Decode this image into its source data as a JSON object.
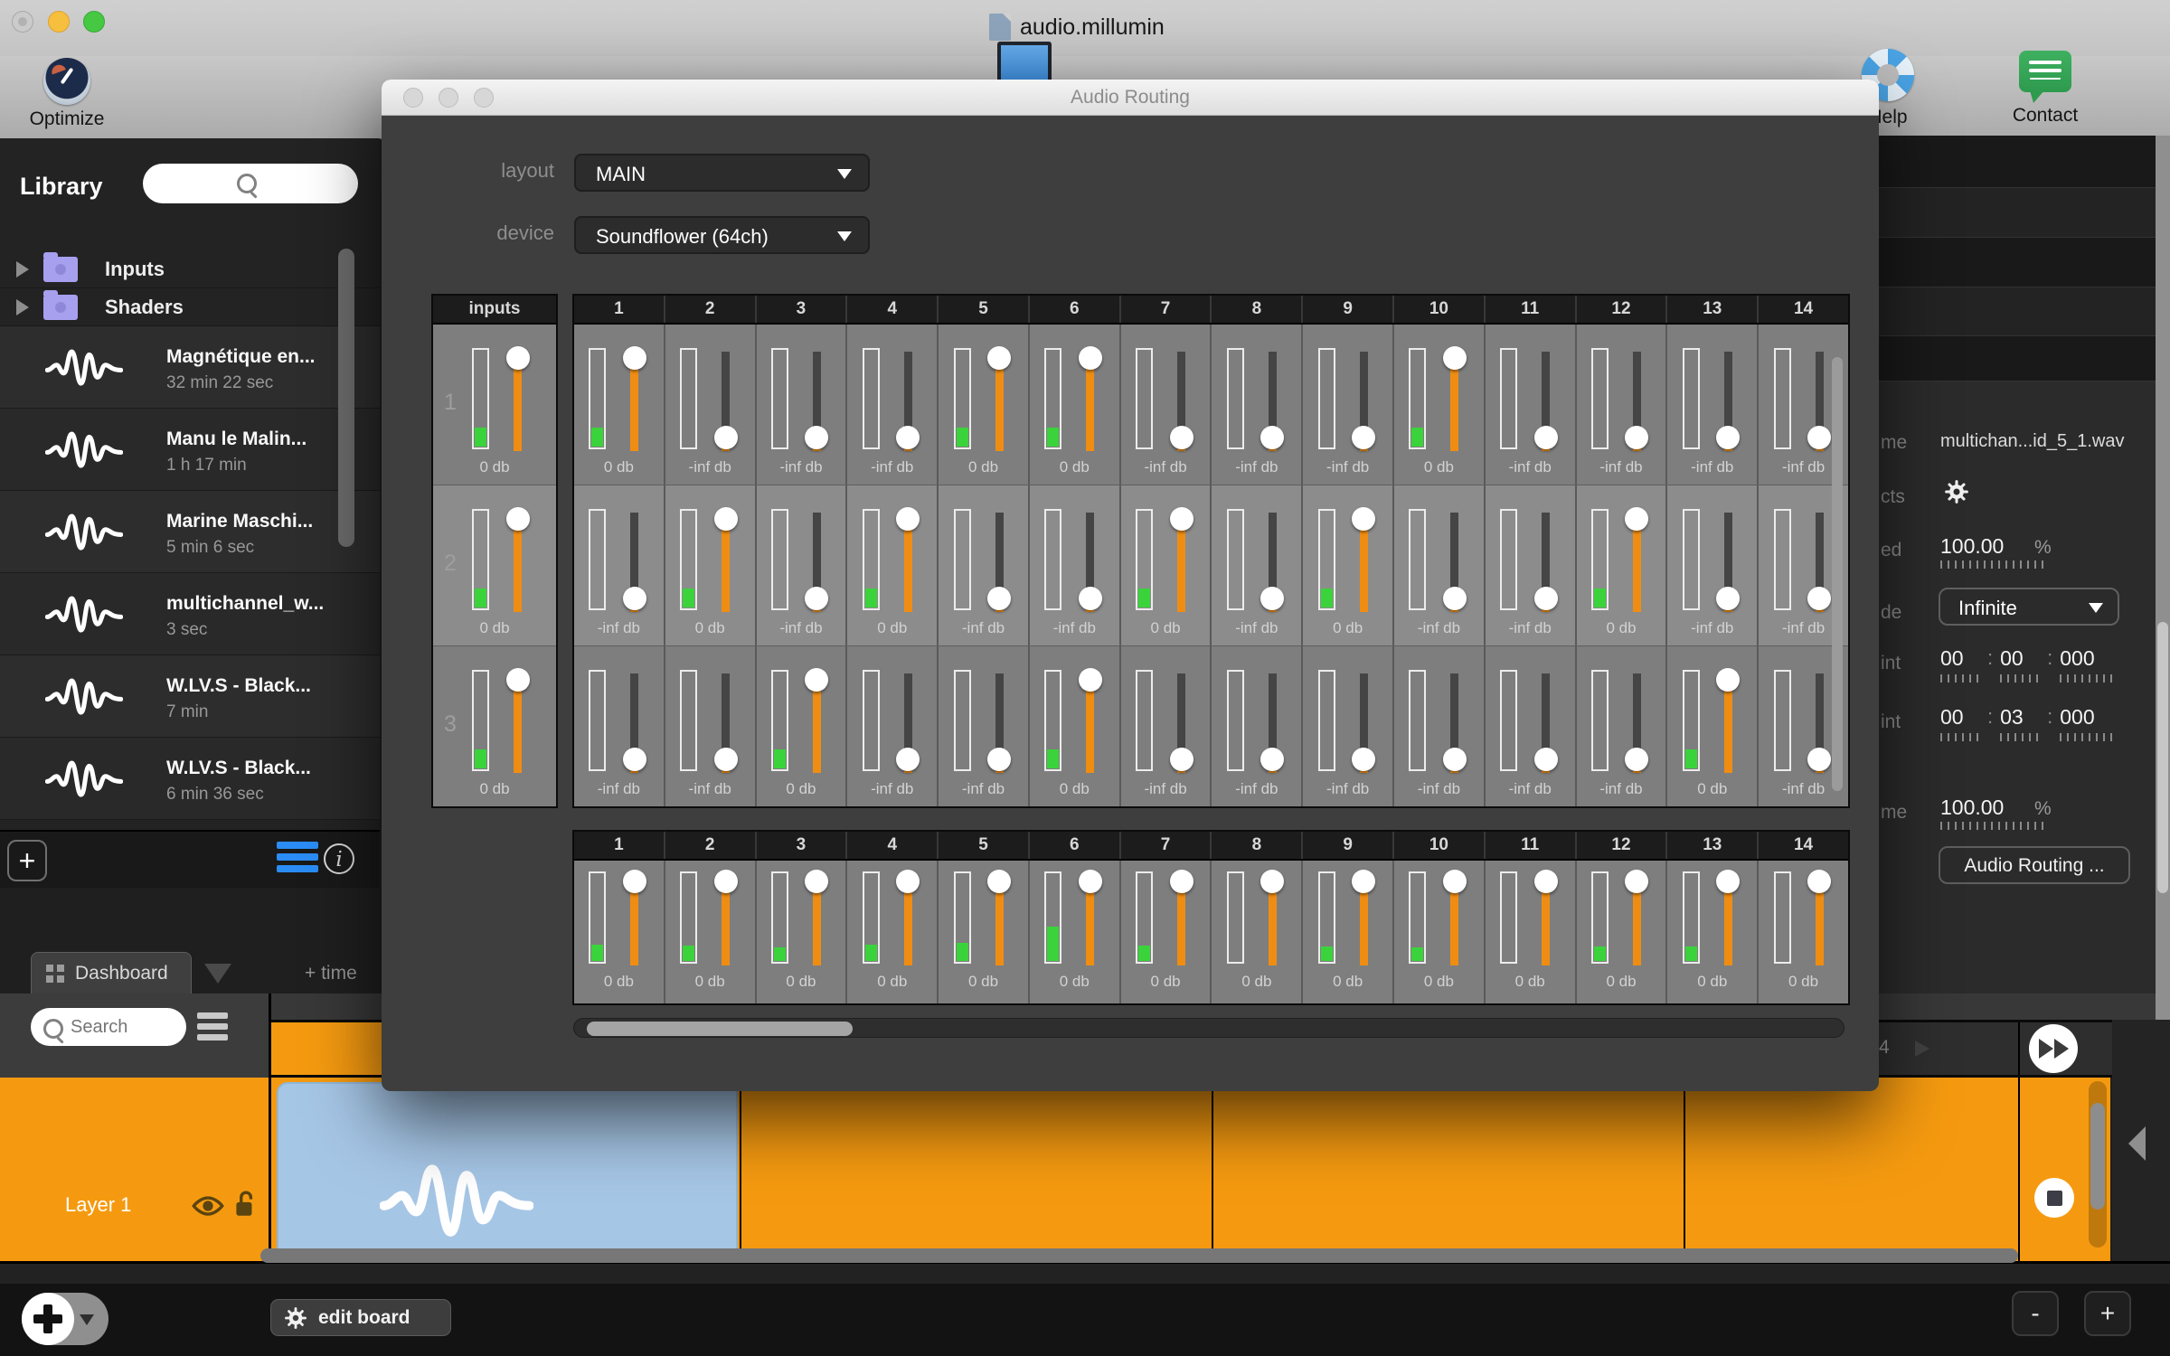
{
  "window": {
    "title": "audio.millumin"
  },
  "toolbar": {
    "optimize_label": "Optimize",
    "help_label": "Help",
    "contact_label": "Contact"
  },
  "sidebar": {
    "title": "Library",
    "search_placeholder": "",
    "folders": [
      {
        "label": "Inputs"
      },
      {
        "label": "Shaders"
      }
    ],
    "items": [
      {
        "name": "Magnétique en...",
        "duration": "32 min 22 sec"
      },
      {
        "name": "Manu le Malin...",
        "duration": "1 h  17 min"
      },
      {
        "name": "Marine Maschi...",
        "duration": "5 min 6 sec"
      },
      {
        "name": "multichannel_w...",
        "duration": "3 sec"
      },
      {
        "name": "W.LV.S - Black...",
        "duration": "7 min"
      },
      {
        "name": "W.LV.S - Black...",
        "duration": "6 min 36 sec"
      }
    ]
  },
  "dialog": {
    "title": "Audio Routing",
    "layout_label": "layout",
    "layout_value": "MAIN",
    "device_label": "device",
    "device_value": "Soundflower (64ch)",
    "matrix": {
      "inputs_header": "inputs",
      "columns": [
        "1",
        "2",
        "3",
        "4",
        "5",
        "6",
        "7",
        "8",
        "9",
        "10",
        "11",
        "12",
        "13",
        "14"
      ],
      "input_rows": [
        {
          "number": "1",
          "label": "0 db",
          "level": 0.2
        },
        {
          "number": "2",
          "label": "0 db",
          "level": 0.2
        },
        {
          "number": "3",
          "label": "0 db",
          "level": 0.2
        }
      ],
      "rows": [
        [
          "0 db",
          "-inf db",
          "-inf db",
          "-inf db",
          "0 db",
          "0 db",
          "-inf db",
          "-inf db",
          "-inf db",
          "0 db",
          "-inf db",
          "-inf db",
          "-inf db",
          "-inf db"
        ],
        [
          "-inf db",
          "0 db",
          "-inf db",
          "0 db",
          "-inf db",
          "-inf db",
          "0 db",
          "-inf db",
          "0 db",
          "-inf db",
          "-inf db",
          "0 db",
          "-inf db",
          "-inf db"
        ],
        [
          "-inf db",
          "-inf db",
          "0 db",
          "-inf db",
          "-inf db",
          "0 db",
          "-inf db",
          "-inf db",
          "-inf db",
          "-inf db",
          "-inf db",
          "-inf db",
          "0 db",
          "-inf db"
        ]
      ],
      "active_level": 0.2
    },
    "outputs": {
      "columns": [
        "1",
        "2",
        "3",
        "4",
        "5",
        "6",
        "7",
        "8",
        "9",
        "10",
        "11",
        "12",
        "13",
        "14"
      ],
      "labels": [
        "0 db",
        "0 db",
        "0 db",
        "0 db",
        "0 db",
        "0 db",
        "0 db",
        "0 db",
        "0 db",
        "0 db",
        "0 db",
        "0 db",
        "0 db",
        "0 db"
      ],
      "levels": [
        0.17,
        0.16,
        0.14,
        0.17,
        0.19,
        0.37,
        0.16,
        0,
        0.15,
        0.14,
        0,
        0.15,
        0.15,
        0
      ]
    }
  },
  "right_panel": {
    "name_label": "me",
    "name_value": "multichan...id_5_1.wav",
    "effects_label": "cts",
    "speed_label": "ed",
    "speed_value": "100.00",
    "speed_unit": "%",
    "mode_label": "de",
    "mode_value": "Infinite",
    "in_label": "int",
    "in_h": "00",
    "in_m": "00",
    "in_ms": "000",
    "out_label": "int",
    "out_h": "00",
    "out_m": "03",
    "out_ms": "000",
    "volume_label": "me",
    "volume_value": "100.00",
    "volume_unit": "%",
    "time_separator": ":",
    "routing_button": "Audio Routing ..."
  },
  "bottom": {
    "tab_label": "Dashboard",
    "add_timeline": "+ time",
    "search_placeholder": "Search",
    "layer_label": "Layer 1",
    "column_number": "4",
    "edit_board": "edit board",
    "zoom_out": "-",
    "zoom_in": "+"
  },
  "colors": {
    "accent_orange": "#f59a10",
    "fader_orange": "#ef8d13",
    "meter_green": "#3bd33b",
    "clip_blue": "#a6c6e6",
    "link_blue": "#2a8cf4"
  }
}
